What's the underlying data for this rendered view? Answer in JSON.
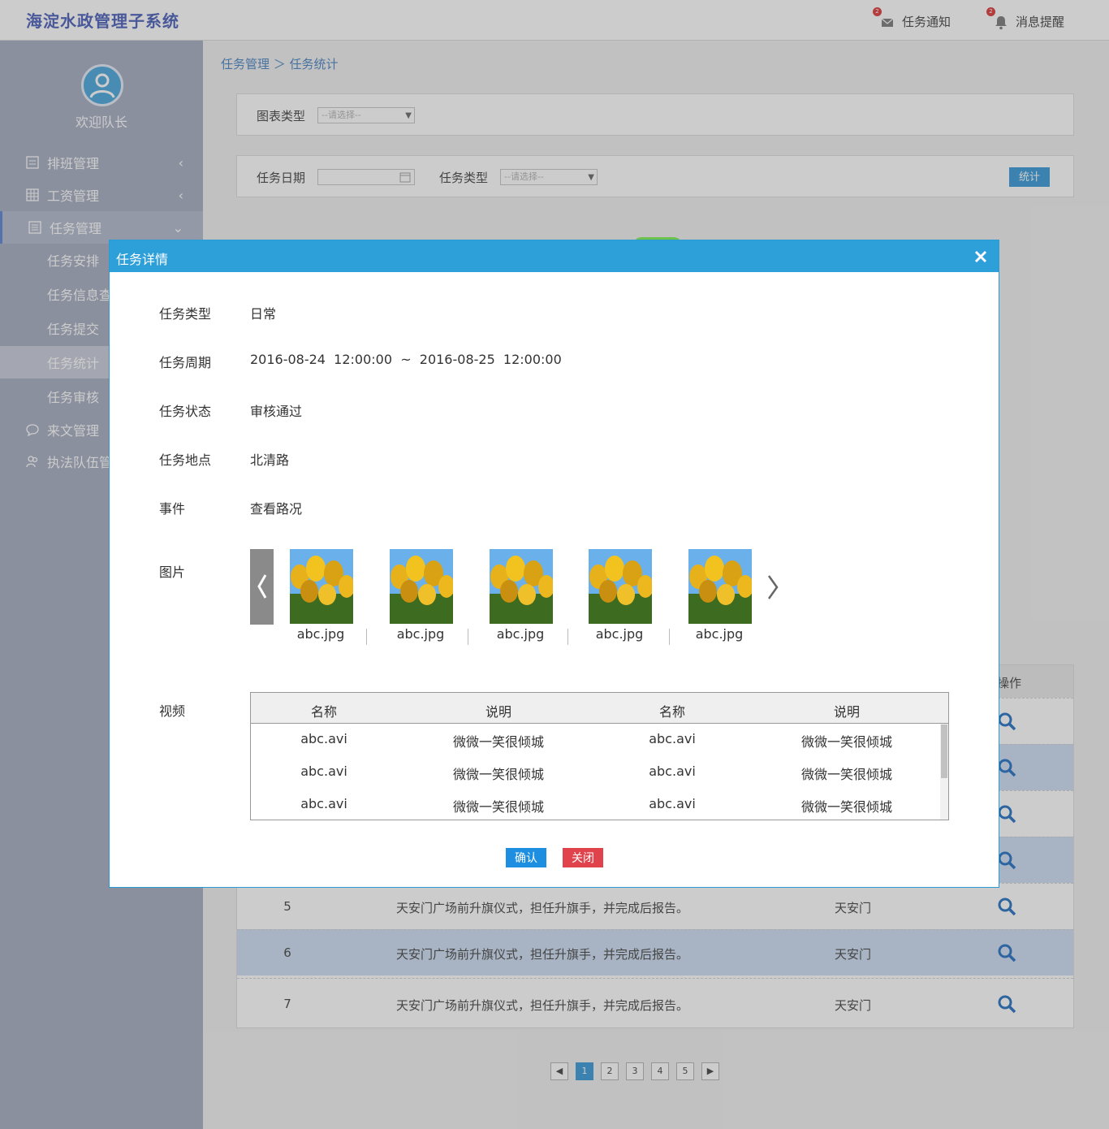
{
  "app": {
    "title": "海淀水政管理子系统"
  },
  "topbar": {
    "task_notice": {
      "label": "任务通知",
      "badge": "2"
    },
    "message_alert": {
      "label": "消息提醒",
      "badge": "2"
    }
  },
  "sidebar": {
    "welcome": "欢迎队长",
    "items": [
      {
        "label": "排班管理",
        "icon": "calendar-list-icon"
      },
      {
        "label": "工资管理",
        "icon": "grid-icon"
      },
      {
        "label": "任务管理",
        "icon": "list-icon"
      },
      {
        "label": "来文管理",
        "icon": "chat-bubble-icon"
      },
      {
        "label": "执法队伍管",
        "icon": "team-icon"
      }
    ],
    "sub_items": [
      "任务安排",
      "任务信息查",
      "任务提交",
      "任务统计",
      "任务审核"
    ]
  },
  "main": {
    "breadcrumb": "任务管理 ＞ 任务统计",
    "filter1": {
      "label": "图表类型",
      "placeholder": "--请选择--"
    },
    "filter2": {
      "date_label": "任务日期",
      "type_label": "任务类型",
      "type_placeholder": "--请选择--",
      "button": "统计"
    },
    "table": {
      "ops_header": "操作",
      "rows": [
        {
          "no": "5",
          "desc": "天安门广场前升旗仪式，担任升旗手，并完成后报告。",
          "loc": "天安门"
        },
        {
          "no": "6",
          "desc": "天安门广场前升旗仪式，担任升旗手，并完成后报告。",
          "loc": "天安门"
        },
        {
          "no": "7",
          "desc": "天安门广场前升旗仪式，担任升旗手，并完成后报告。",
          "loc": "天安门"
        }
      ]
    },
    "pagination": [
      "1",
      "2",
      "3",
      "4",
      "5"
    ]
  },
  "modal": {
    "title": "任务详情",
    "fields": [
      {
        "label": "任务类型",
        "value": "日常"
      },
      {
        "label": "任务周期",
        "value": "2016-08-24  12:00:00  ~  2016-08-25  12:00:00"
      },
      {
        "label": "任务状态",
        "value": "审核通过"
      },
      {
        "label": "任务地点",
        "value": "北清路"
      },
      {
        "label": "事件",
        "value": "查看路况"
      }
    ],
    "images_label": "图片",
    "images": [
      "abc.jpg",
      "abc.jpg",
      "abc.jpg",
      "abc.jpg",
      "abc.jpg"
    ],
    "video_label": "视频",
    "video_headers": [
      "名称",
      "说明",
      "名称",
      "说明"
    ],
    "video_rows": [
      [
        "abc.avi",
        "微微一笑很倾城",
        "abc.avi",
        "微微一笑很倾城"
      ],
      [
        "abc.avi",
        "微微一笑很倾城",
        "abc.avi",
        "微微一笑很倾城"
      ],
      [
        "abc.avi",
        "微微一笑很倾城",
        "abc.avi",
        "微微一笑很倾城"
      ]
    ],
    "confirm": "确认",
    "close": "关闭"
  },
  "colors": {
    "modal_header": "#2d9fd9",
    "confirm_button": "#1e8fe0",
    "close_button": "#e0434b",
    "title_text": "#5b6fc0"
  }
}
